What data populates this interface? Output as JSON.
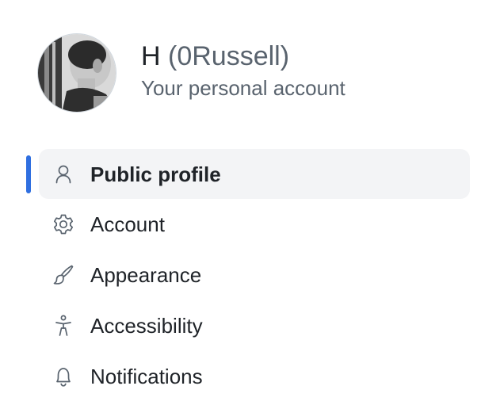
{
  "profile": {
    "display_name": "H",
    "login": "(0Russell)",
    "subtitle": "Your personal account"
  },
  "nav": {
    "items": [
      {
        "label": "Public profile",
        "icon": "person-icon",
        "active": true
      },
      {
        "label": "Account",
        "icon": "gear-icon",
        "active": false
      },
      {
        "label": "Appearance",
        "icon": "paintbrush-icon",
        "active": false
      },
      {
        "label": "Accessibility",
        "icon": "accessibility-icon",
        "active": false
      },
      {
        "label": "Notifications",
        "icon": "bell-icon",
        "active": false
      }
    ]
  },
  "colors": {
    "active_indicator": "#2f6fe0",
    "active_bg": "#f3f4f6",
    "muted_text": "#59636e",
    "primary_text": "#1f2328"
  }
}
